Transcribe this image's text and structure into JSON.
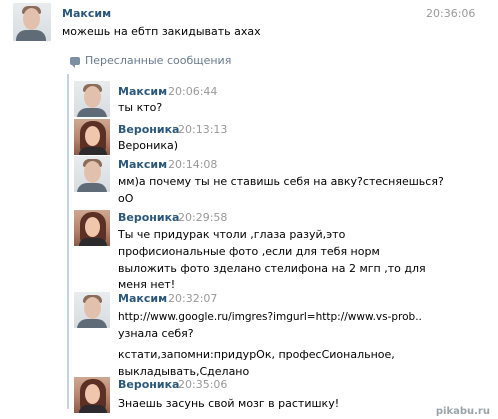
{
  "main_message": {
    "sender": "Максим",
    "time": "20:36:06",
    "text": "можешь на ебтп закидывать ахах"
  },
  "forwarded": {
    "label": "Пересланные сообщения",
    "icon": "speech-bubble-icon",
    "messages": [
      {
        "sender": "Максим",
        "time": "20:06:44",
        "lines": [
          "ты кто?"
        ]
      },
      {
        "sender": "Вероника",
        "time": "20:13:13",
        "lines": [
          "Вероника)"
        ]
      },
      {
        "sender": "Максим",
        "time": "20:14:08",
        "lines": [
          "мм)а почему ты не ставишь себя на авку?стесняешься?",
          "оО"
        ]
      },
      {
        "sender": "Вероника",
        "time": "20:29:58",
        "lines": [
          "Ты че придурак чтоли ,глаза разуй,это",
          "профисиональные фото ,если для тебя норм",
          "выложить фото зделано стелифона на 2 мгп ,то для",
          "меня нет!"
        ]
      },
      {
        "sender": "Максим",
        "time": "20:32:07",
        "lines": [
          "http://www.google.ru/imgres?imgurl=http://www.vs-prob..",
          "узнала себя?",
          "кстати,запомни:придурОк, професСиональное,",
          "выкладывать,Сделано"
        ]
      },
      {
        "sender": "Вероника",
        "time": "20:35:06",
        "lines": [
          "Знаешь засунь свой мозг в растишку!"
        ]
      }
    ]
  },
  "watermark": "pikabu.ru",
  "colors": {
    "name": "#2b587a",
    "time": "#999999",
    "quote_bar": "#c5d2df"
  }
}
